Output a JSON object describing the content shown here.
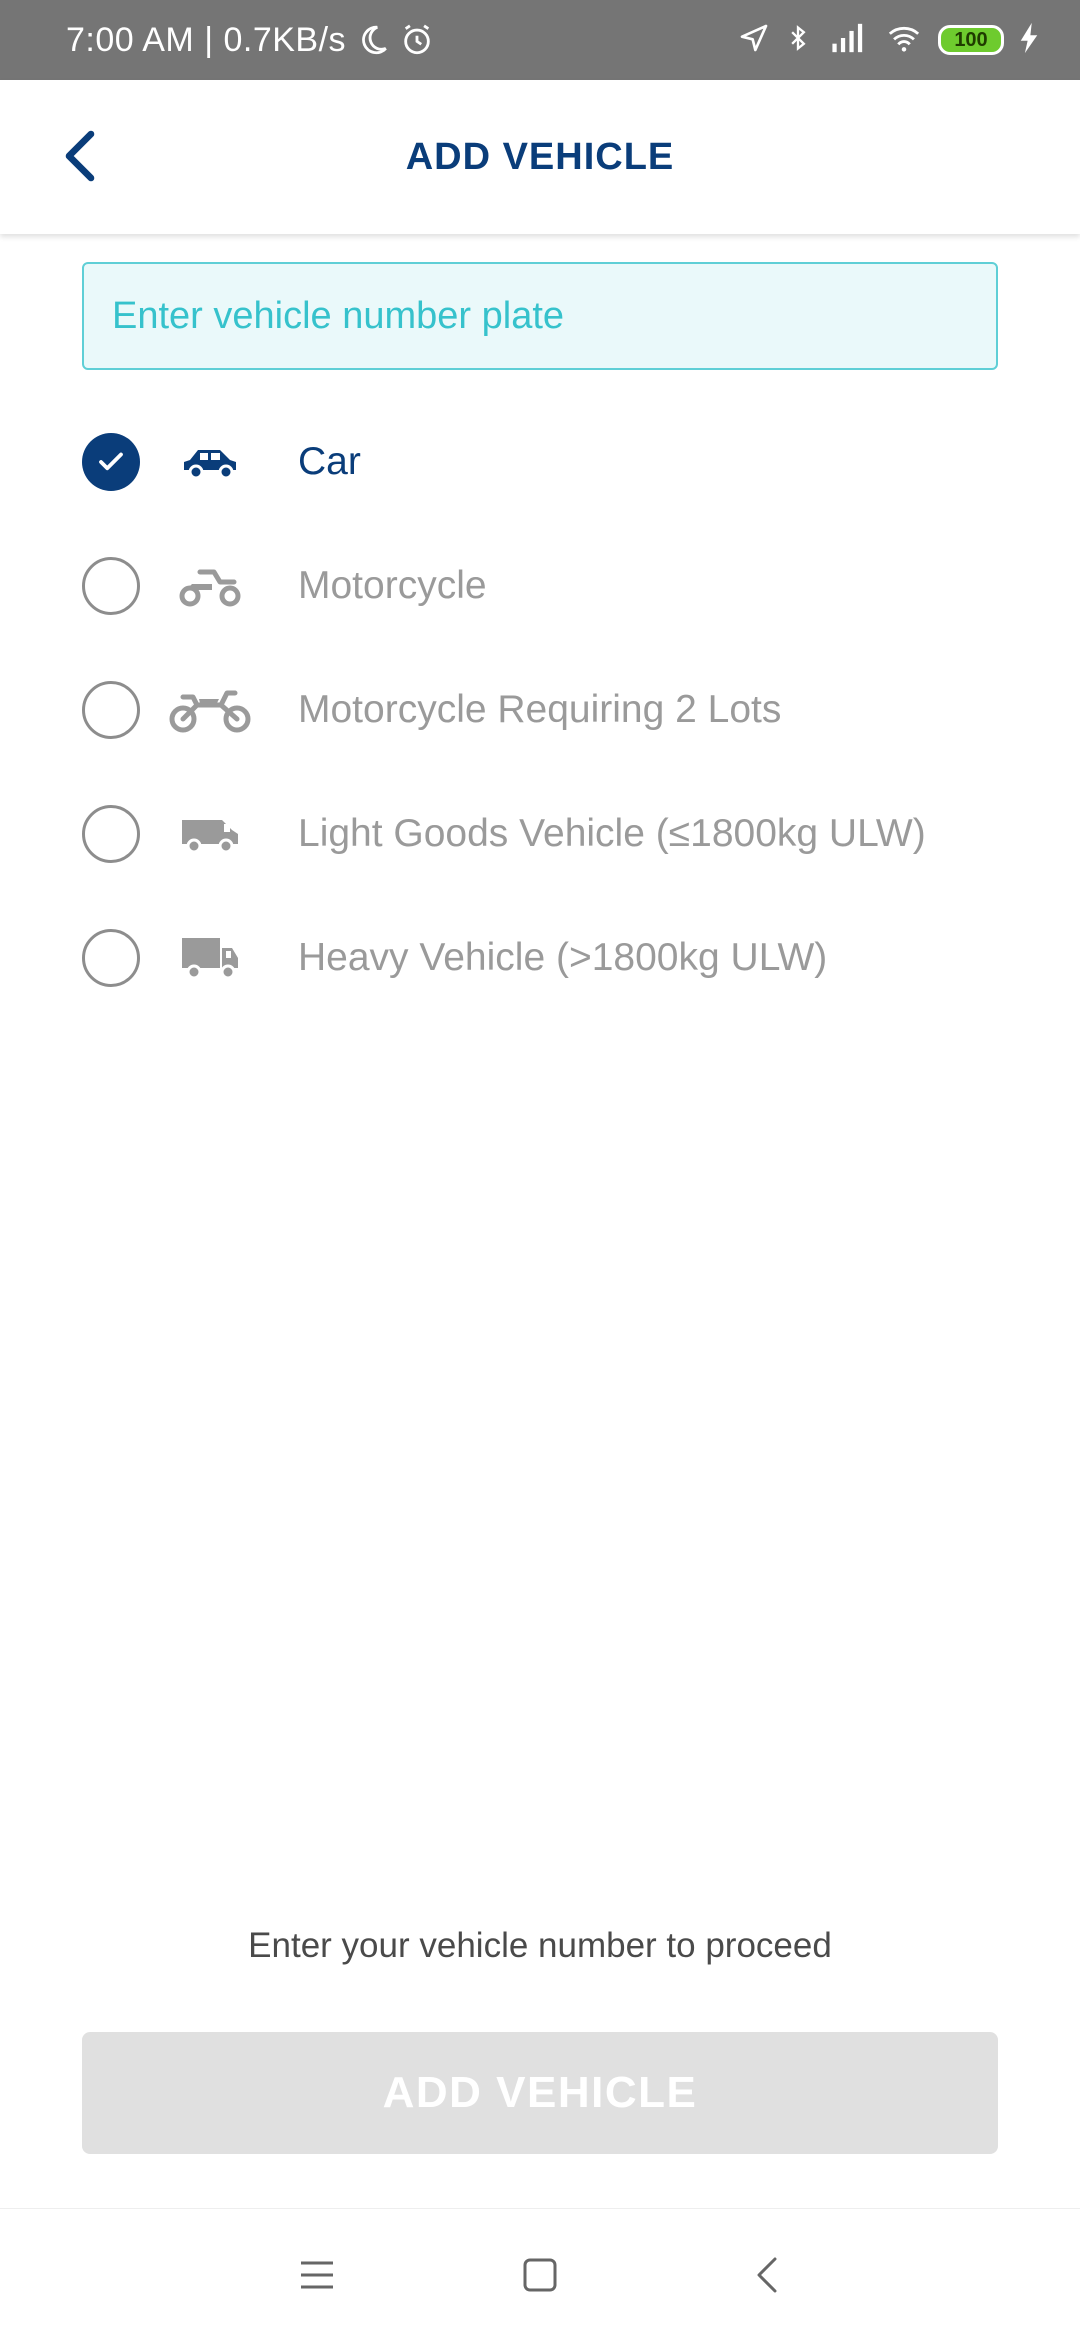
{
  "status_bar": {
    "time_speed": "7:00 AM | 0.7KB/s",
    "battery": "100",
    "icons": [
      "moon-icon",
      "alarm-icon",
      "location-icon",
      "bluetooth-icon",
      "signal-icon",
      "wifi-icon",
      "battery-icon",
      "charging-icon"
    ]
  },
  "header": {
    "title": "ADD VEHICLE",
    "back_icon": "chevron-left-icon"
  },
  "plate_input": {
    "placeholder": "Enter vehicle number plate",
    "value": ""
  },
  "vehicle_types": [
    {
      "label": "Car",
      "icon": "car-icon",
      "selected": true
    },
    {
      "label": "Motorcycle",
      "icon": "scooter-icon",
      "selected": false
    },
    {
      "label": "Motorcycle Requiring 2 Lots",
      "icon": "motorcycle-icon",
      "selected": false
    },
    {
      "label": "Light Goods Vehicle (≤1800kg ULW)",
      "icon": "van-icon",
      "selected": false
    },
    {
      "label": "Heavy Vehicle (>1800kg ULW)",
      "icon": "truck-icon",
      "selected": false
    }
  ],
  "hint": "Enter your vehicle number to proceed",
  "add_button": {
    "label": "ADD VEHICLE",
    "enabled": false
  },
  "nav_bar": {
    "icons": [
      "menu-icon",
      "home-icon",
      "back-icon"
    ]
  },
  "colors": {
    "primary": "#0a3d7a",
    "accent": "#36c2cc",
    "input_bg": "#eaf9fa",
    "disabled_button": "#e0e0e0",
    "muted_text": "#9a9a9a",
    "status_bar": "#757575"
  }
}
